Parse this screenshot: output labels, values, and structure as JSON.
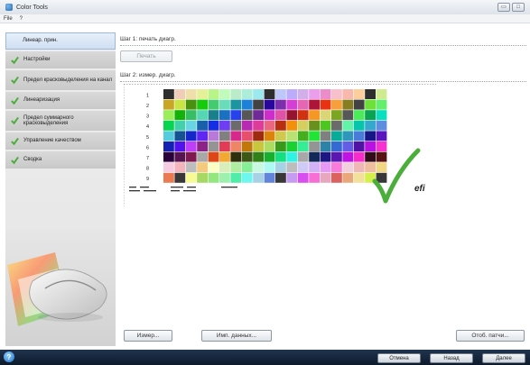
{
  "window": {
    "title": "Color Tools"
  },
  "menu": [
    "File",
    "?"
  ],
  "sidebar": {
    "items": [
      {
        "label": "Линеар. прин.",
        "active": true,
        "checked": false
      },
      {
        "label": "Настройки",
        "active": false,
        "checked": true
      },
      {
        "label": "Предел красковыделения на канал",
        "active": false,
        "checked": true
      },
      {
        "label": "Линеаризация",
        "active": false,
        "checked": true
      },
      {
        "label": "Предел суммарного красковыделения",
        "active": false,
        "checked": true
      },
      {
        "label": "Управление качеством",
        "active": false,
        "checked": true
      },
      {
        "label": "Сводка",
        "active": false,
        "checked": true
      }
    ]
  },
  "main": {
    "step1_label": "Шаг 1: печать диагр.",
    "print_button": "Печать",
    "step2_label": "Шаг 2: измер. диагр.",
    "measure_button": "Измер...",
    "import_button": "Имп. данных...",
    "show_patches_button": "Отоб. патчи..."
  },
  "target_chart": {
    "row_labels": [
      "1",
      "2",
      "3",
      "4",
      "5",
      "6",
      "7",
      "8",
      "9"
    ],
    "logo_text": "efi"
  },
  "footer": {
    "cancel": "Отмена",
    "back": "Назад",
    "next": "Далее",
    "help_icon_glyph": "?"
  },
  "colors": {
    "check_green": "#4cae3a",
    "accent_blue": "#9fb8d8"
  }
}
